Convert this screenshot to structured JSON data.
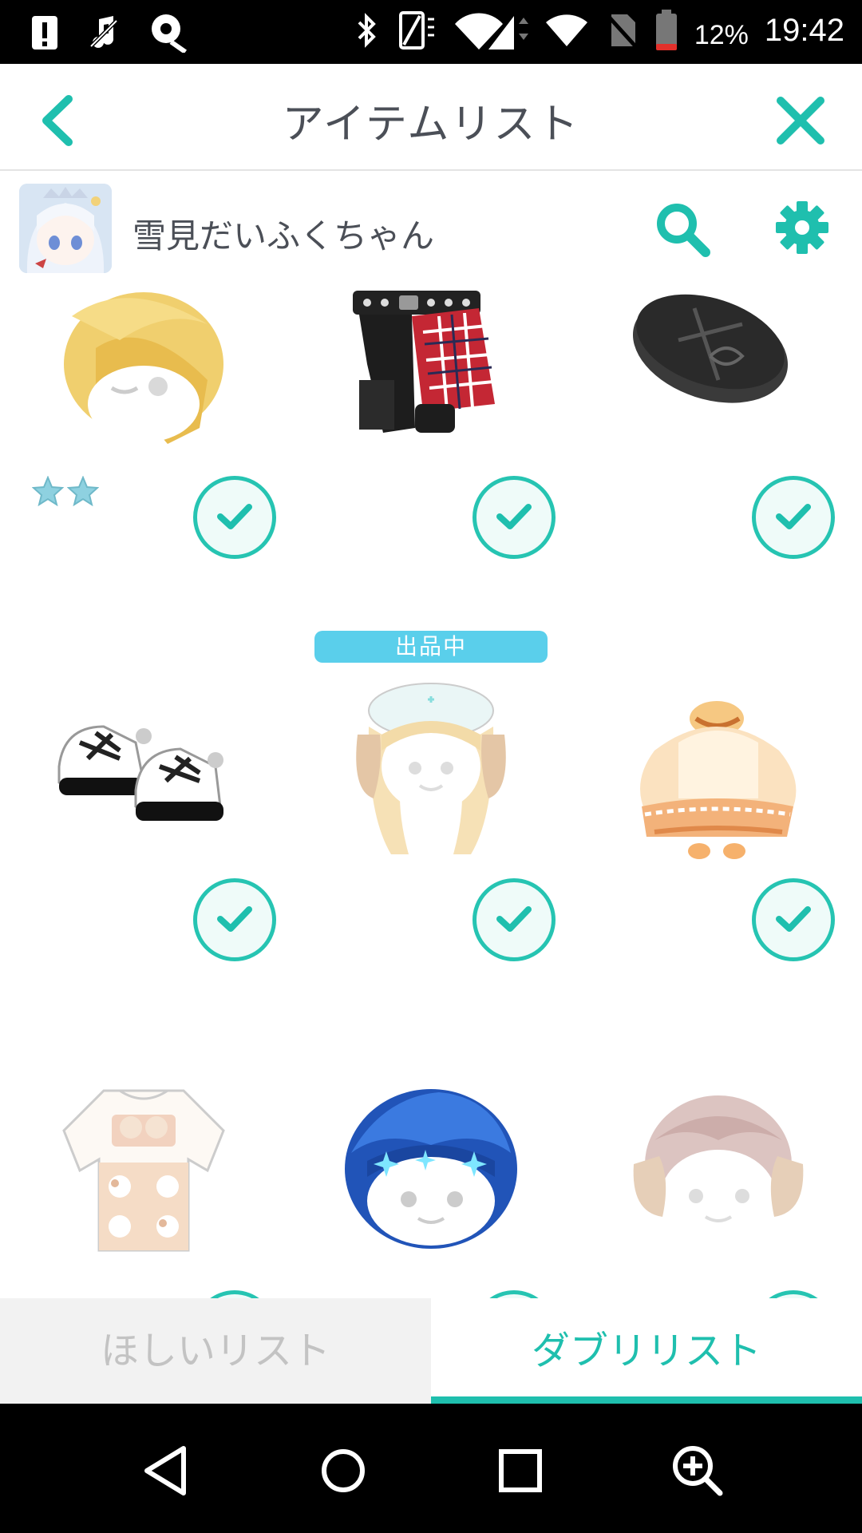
{
  "status_bar": {
    "battery_percent": "12%",
    "time": "19:42",
    "icons": [
      "alert-icon",
      "music-off-icon",
      "vpn-key-icon",
      "bluetooth-icon",
      "vibrate-icon",
      "signal-icon",
      "wifi-icon",
      "no-sim-icon",
      "battery-icon"
    ]
  },
  "header": {
    "title": "アイテムリスト",
    "back_icon": "chevron-left-icon",
    "close_icon": "close-icon",
    "accent": "#1fbfae"
  },
  "user": {
    "name": "雪見だいふくちゃん",
    "search_icon": "search-icon",
    "settings_icon": "gear-icon"
  },
  "items": [
    {
      "name": "blonde hair",
      "checked": true,
      "stars": 2
    },
    {
      "name": "black plaid pants",
      "checked": true
    },
    {
      "name": "black beret",
      "checked": true
    },
    {
      "name": "white boots",
      "checked": true
    },
    {
      "name": "nurse cap twin tails hair",
      "checked": true,
      "badge": "出品中"
    },
    {
      "name": "orange frilly dress",
      "checked": true
    },
    {
      "name": "puppy print outfit",
      "checked": true
    },
    {
      "name": "blue sparkle hair",
      "checked": true
    },
    {
      "name": "puppy ear hair",
      "checked": true
    }
  ],
  "badge": {
    "label": "出品中",
    "color": "#5acfeb"
  },
  "tabs": {
    "wishlist": "ほしいリスト",
    "duplicates": "ダブリリスト",
    "active": "duplicates"
  },
  "nav": {
    "icons": [
      "back-triangle-icon",
      "home-circle-icon",
      "recents-square-icon",
      "zoom-in-icon"
    ]
  }
}
